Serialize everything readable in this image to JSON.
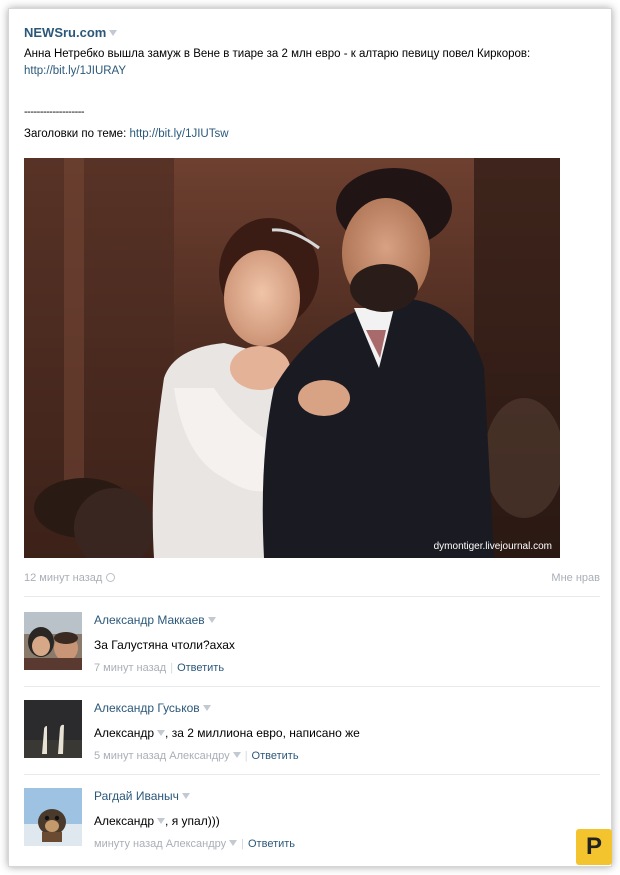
{
  "post": {
    "source": "NEWSru.com",
    "text": "Анна Нетребко вышла замуж в Вене в тиаре за 2 млн евро - к алтарю певицу повел Киркоров:",
    "link": "http://bit.ly/1JIURAY",
    "divider": "-------------------",
    "related_label": "Заголовки по теме:",
    "related_link": "http://bit.ly/1JIUTsw",
    "photo_credit": "dymontiger.livejournal.com",
    "time": "12 минут назад",
    "like": "Мне нрав"
  },
  "comments": [
    {
      "author": "Александр Маккаев",
      "mention": "",
      "text": "За Галустяна чтоли?ахах",
      "time": "7 минут назад",
      "reply_to": "",
      "reply": "Ответить"
    },
    {
      "author": "Александр Гуськов",
      "mention": "Александр",
      "text": ", за 2 миллиона евро, написано же",
      "time": "5 минут назад",
      "reply_to": "Александру",
      "reply": "Ответить"
    },
    {
      "author": "Рагдай Иваныч",
      "mention": "Александр",
      "text": ", я упал)))",
      "time": "минуту назад",
      "reply_to": "Александру",
      "reply": "Ответить"
    }
  ],
  "badge": "P",
  "colors": {
    "link": "#2b587a",
    "muted": "#a9afb7",
    "badge": "#f3c42d"
  }
}
